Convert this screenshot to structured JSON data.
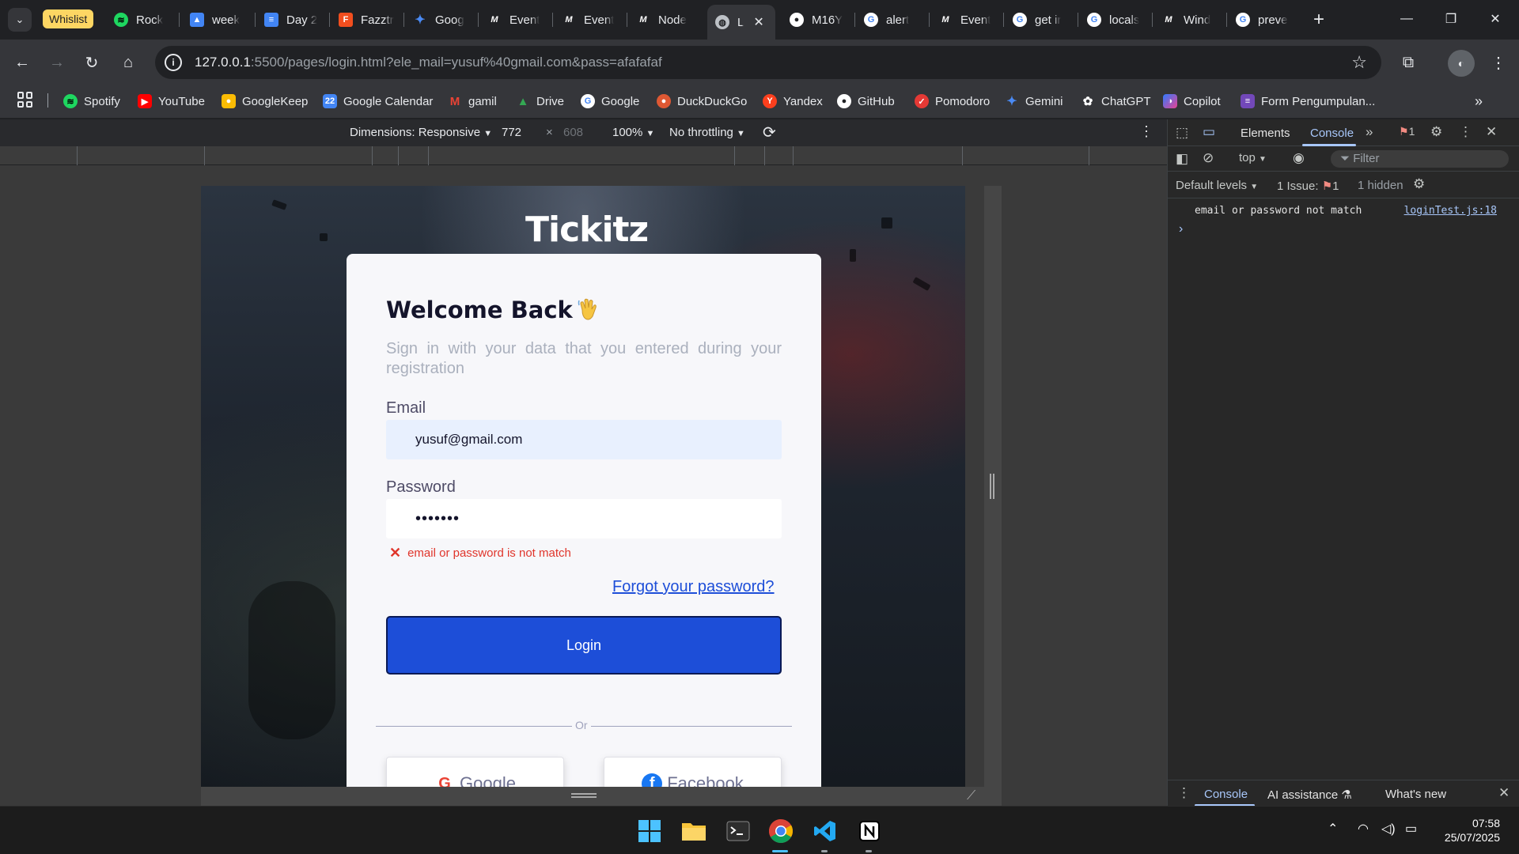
{
  "browser": {
    "tab_group_label": "Whislist",
    "tabs": [
      {
        "title": "Rock",
        "icon": "spotify-icon",
        "color": "#1ed760"
      },
      {
        "title": "week",
        "icon": "drive-icon",
        "color": "#4285f4"
      },
      {
        "title": "Day 2",
        "icon": "docs-icon",
        "color": "#4285f4"
      },
      {
        "title": "Fazztr",
        "icon": "figma-icon",
        "color": "#f24e1e"
      },
      {
        "title": "Goog",
        "icon": "gemini-icon",
        "color": "#4a8af4"
      },
      {
        "title": "Event",
        "icon": "m-icon",
        "color": "#ffffff"
      },
      {
        "title": "Event",
        "icon": "m-icon",
        "color": "#ffffff"
      },
      {
        "title": "Node",
        "icon": "m-icon",
        "color": "#ffffff"
      },
      {
        "title": "L",
        "icon": "globe-icon",
        "color": "#bdc1c6",
        "active": true
      },
      {
        "title": "M16Y",
        "icon": "github-icon",
        "color": "#ffffff"
      },
      {
        "title": "alert",
        "icon": "google-icon",
        "color": "#4285f4"
      },
      {
        "title": "Event",
        "icon": "m-icon",
        "color": "#ffffff"
      },
      {
        "title": "get ir",
        "icon": "google-icon",
        "color": "#4285f4"
      },
      {
        "title": "locals",
        "icon": "google-icon",
        "color": "#4285f4"
      },
      {
        "title": "Wind",
        "icon": "m-icon",
        "color": "#ffffff"
      },
      {
        "title": "preve",
        "icon": "google-icon",
        "color": "#4285f4"
      }
    ],
    "url_host": "127.0.0.1",
    "url_rest": ":5500/pages/login.html?ele_mail=yusuf%40gmail.com&pass=afafafaf",
    "bookmarks": [
      {
        "label": "Spotify",
        "icon": "spotify-icon",
        "color": "#1ed760"
      },
      {
        "label": "YouTube",
        "icon": "youtube-icon",
        "color": "#ff0000"
      },
      {
        "label": "GoogleKeep",
        "icon": "keep-icon",
        "color": "#fbbc04"
      },
      {
        "label": "Google Calendar",
        "icon": "calendar-icon",
        "color": "#4285f4"
      },
      {
        "label": "gamil",
        "icon": "gmail-icon",
        "color": "#ea4335"
      },
      {
        "label": "Drive",
        "icon": "drive-icon",
        "color": "#34a853"
      },
      {
        "label": "Google",
        "icon": "google-icon",
        "color": "#4285f4"
      },
      {
        "label": "DuckDuckGo",
        "icon": "duckduckgo-icon",
        "color": "#de5833"
      },
      {
        "label": "Yandex",
        "icon": "yandex-icon",
        "color": "#fc3f1d"
      },
      {
        "label": "GitHub",
        "icon": "github-icon",
        "color": "#ffffff"
      },
      {
        "label": "Pomodoro",
        "icon": "pomodoro-icon",
        "color": "#e53935"
      },
      {
        "label": "Gemini",
        "icon": "gemini-icon",
        "color": "#4a8af4"
      },
      {
        "label": "ChatGPT",
        "icon": "chatgpt-icon",
        "color": "#ffffff"
      },
      {
        "label": "Copilot",
        "icon": "copilot-icon",
        "color": "#7b61ff"
      },
      {
        "label": "Form Pengumpulan...",
        "icon": "forms-icon",
        "color": "#7248b9"
      }
    ]
  },
  "device_toolbar": {
    "dimensions_label": "Dimensions: Responsive",
    "width": "772",
    "times": "×",
    "height": "608",
    "zoom": "100%",
    "throttling": "No throttling"
  },
  "page": {
    "brand": "Tickitz",
    "welcome": "Welcome Back",
    "subtitle": "Sign in with your data that you entered during your registration",
    "email_label": "Email",
    "email_value": "yusuf@gmail.com",
    "password_label": "Password",
    "password_value": "•••••••",
    "error_text": "email or password is not match",
    "forgot_link": "Forgot your password?",
    "login_button": "Login",
    "or_text": "Or",
    "google_button": "Google",
    "facebook_button": "Facebook",
    "colors": {
      "primary": "#1d4ed8",
      "error": "#e0352b"
    }
  },
  "devtools": {
    "tab_elements": "Elements",
    "tab_console": "Console",
    "issues_count": "1",
    "context": "top",
    "filter_placeholder": "Filter",
    "levels": "Default levels",
    "issue_label": "1 Issue:",
    "issue_badge_count": "1",
    "hidden": "1 hidden",
    "console_message": "email or password not match",
    "console_source": "loginTest.js:18",
    "drawer_console": "Console",
    "drawer_ai": "AI assistance",
    "drawer_whats_new": "What's new"
  },
  "taskbar": {
    "time": "07:58",
    "date": "25/07/2025"
  }
}
